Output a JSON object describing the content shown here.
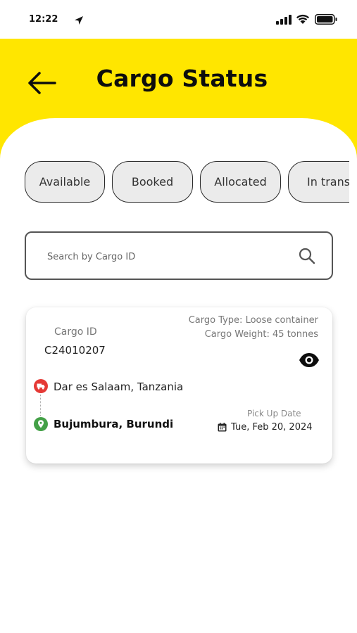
{
  "status_bar": {
    "time": "12:22"
  },
  "header": {
    "title": "Cargo Status"
  },
  "tabs": [
    {
      "label": "Available"
    },
    {
      "label": "Booked"
    },
    {
      "label": "Allocated"
    },
    {
      "label": "In transit"
    }
  ],
  "search": {
    "placeholder": "Search by Cargo ID"
  },
  "cargo_card": {
    "id_label": "Cargo ID",
    "id_value": "C24010207",
    "type": "Cargo Type: Loose container",
    "weight": "Cargo Weight: 45 tonnes",
    "origin": "Dar es Salaam, Tanzania",
    "destination": "Bujumbura, Burundi",
    "pickup_label": "Pick Up Date",
    "pickup_date": "Tue, Feb 20, 2024"
  },
  "colors": {
    "accent": "#FFE600",
    "origin_marker": "#E53935",
    "destination_marker": "#43A047"
  }
}
